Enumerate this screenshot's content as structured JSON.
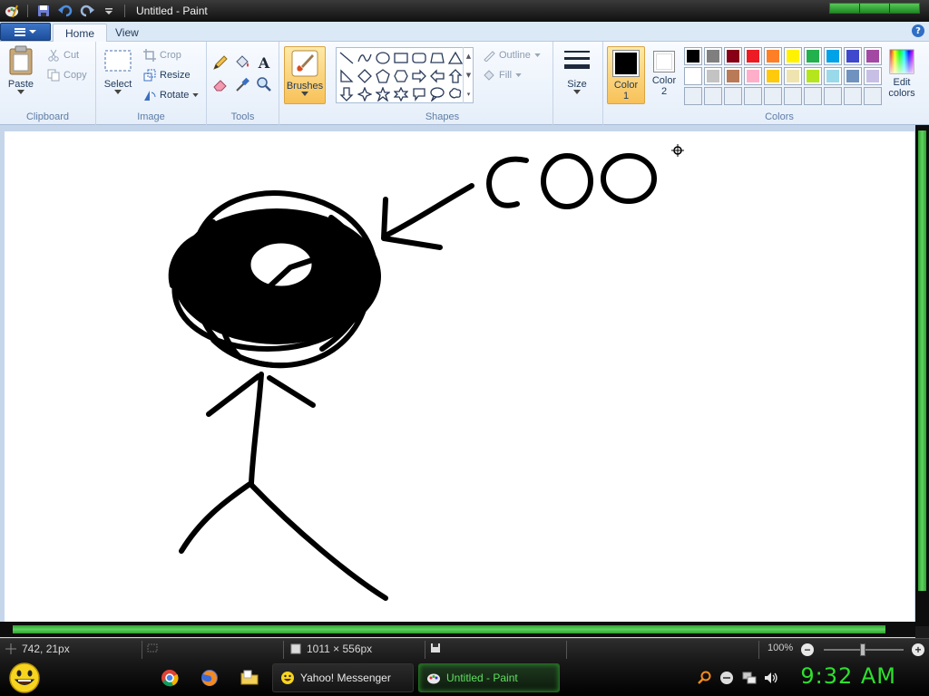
{
  "window": {
    "title": "Untitled - Paint",
    "icons": [
      "paint-app-icon",
      "save-icon",
      "undo-icon",
      "redo-icon",
      "customize-qat-icon"
    ]
  },
  "tabs": {
    "home": "Home",
    "view": "View",
    "help_icon": "?"
  },
  "ribbon": {
    "clipboard": {
      "label": "Clipboard",
      "paste": "Paste",
      "cut": "Cut",
      "copy": "Copy"
    },
    "image": {
      "label": "Image",
      "select": "Select",
      "crop": "Crop",
      "resize": "Resize",
      "rotate": "Rotate"
    },
    "tools": {
      "label": "Tools",
      "items": [
        "pencil-icon",
        "fill-icon",
        "text-icon",
        "eraser-icon",
        "color-picker-icon",
        "magnifier-icon"
      ],
      "text_glyph": "A"
    },
    "brushes": {
      "label": "Brushes"
    },
    "shapes": {
      "label": "Shapes",
      "outline": "Outline",
      "fill": "Fill"
    },
    "size": {
      "label": "Size"
    },
    "color1": {
      "label_line1": "Color",
      "label_line2": "1",
      "value": "#000000"
    },
    "color2": {
      "label_line1": "Color",
      "label_line2": "2",
      "value": "#ffffff"
    },
    "colors": {
      "label": "Colors",
      "palette": [
        "#000000",
        "#7f7f7f",
        "#880015",
        "#ed1c24",
        "#ff7f27",
        "#fff200",
        "#22b14c",
        "#00a2e8",
        "#3f48cc",
        "#a349a4",
        "#ffffff",
        "#c3c3c3",
        "#b97a57",
        "#ffaec9",
        "#ffc90e",
        "#efe4b0",
        "#b5e61d",
        "#99d9ea",
        "#7092be",
        "#c8bfe7"
      ],
      "empty_slots": 10
    },
    "edit_colors": {
      "line1": "Edit",
      "line2": "colors"
    }
  },
  "canvas": {
    "text": "COO",
    "drawing": "stick-figure-with-scribbled-head-and-arrow"
  },
  "status": {
    "cursor_position": "742, 21px",
    "canvas_size": "1011 × 556px",
    "zoom": "100%"
  },
  "taskbar": {
    "tasks": [
      {
        "label": "Yahoo! Messenger",
        "active": false
      },
      {
        "label": "Untitled - Paint",
        "active": true
      }
    ],
    "clock": "9:32 AM",
    "theme_accent": "#2de02d"
  }
}
